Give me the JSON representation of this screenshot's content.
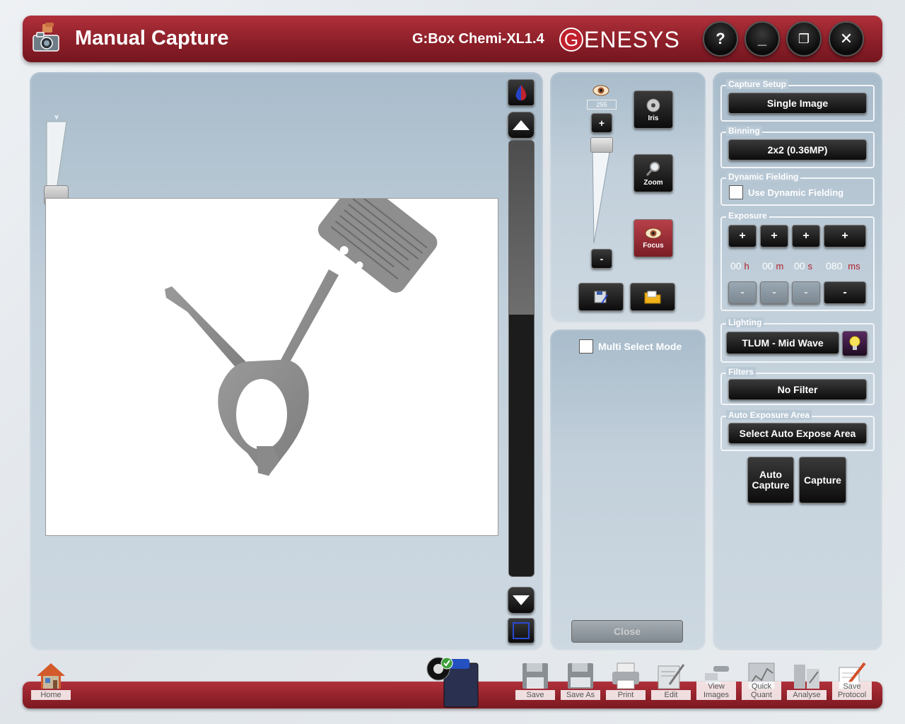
{
  "window": {
    "title": "Manual Capture",
    "device": "G:Box Chemi-XL1.4",
    "logo_initial": "G",
    "logo_rest": "ENESYS",
    "help_label": "?",
    "minimize_label": "_",
    "restore_label": "❐",
    "close_label": "✕"
  },
  "display": {
    "brightness_value": "255",
    "plus_label": "+",
    "minus_label": "-",
    "iris_label": "Iris",
    "zoom_label": "Zoom",
    "focus_label": "Focus",
    "multi_select_label": "Multi Select Mode",
    "close_label": "Close"
  },
  "settings": {
    "capture_setup": {
      "label": "Capture Setup",
      "value": "Single Image"
    },
    "binning": {
      "label": "Binning",
      "value": "2x2 (0.36MP)"
    },
    "dynamic_fielding": {
      "label": "Dynamic Fielding",
      "option": "Use Dynamic Fielding",
      "checked": false
    },
    "exposure": {
      "label": "Exposure",
      "plus": "+",
      "minus": "-",
      "hours": "00",
      "hours_unit": "h",
      "minutes": "00",
      "minutes_unit": "m",
      "seconds": "00",
      "seconds_unit": "s",
      "ms": "080",
      "ms_unit": "ms"
    },
    "lighting": {
      "label": "Lighting",
      "value": "TLUM - Mid Wave"
    },
    "filters": {
      "label": "Filters",
      "value": "No Filter"
    },
    "auto_exposure_area": {
      "label": "Auto Exposure Area",
      "value": "Select Auto Expose Area"
    },
    "auto_capture_label": "Auto Capture",
    "capture_label": "Capture"
  },
  "toolbar": {
    "home": "Home",
    "save": "Save",
    "save_as": "Save As",
    "print": "Print",
    "edit": "Edit",
    "view_images": "View Images",
    "quick_quant": "Quick Quant",
    "analyse": "Analyse",
    "save_protocol": "Save Protocol"
  },
  "colors": {
    "accent": "#8a1e28",
    "button": "#111111",
    "focus_button": "#9a2a33"
  }
}
